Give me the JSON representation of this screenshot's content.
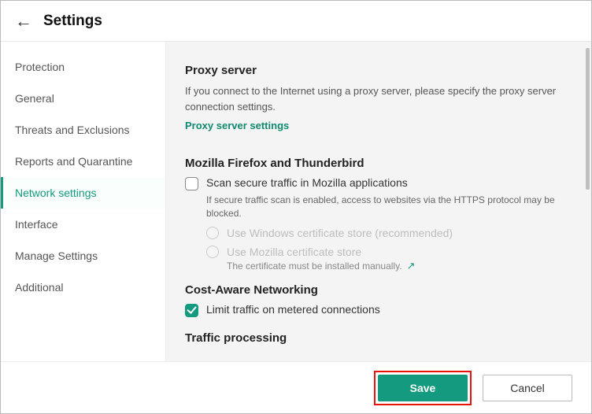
{
  "header": {
    "title": "Settings"
  },
  "sidebar": {
    "items": [
      {
        "label": "Protection"
      },
      {
        "label": "General"
      },
      {
        "label": "Threats and Exclusions"
      },
      {
        "label": "Reports and Quarantine"
      },
      {
        "label": "Network settings"
      },
      {
        "label": "Interface"
      },
      {
        "label": "Manage Settings"
      },
      {
        "label": "Additional"
      }
    ],
    "active_index": 4
  },
  "content": {
    "proxy": {
      "heading": "Proxy server",
      "desc": "If you connect to the Internet using a proxy server, please specify the proxy server connection settings.",
      "link": "Proxy server settings"
    },
    "mozilla": {
      "heading": "Mozilla Firefox and Thunderbird",
      "check_label": "Scan secure traffic in Mozilla applications",
      "subnote": "If secure traffic scan is enabled, access to websites via the HTTPS protocol may be blocked.",
      "radio1": "Use Windows certificate store (recommended)",
      "radio2": "Use Mozilla certificate store",
      "radio2_sub": "The certificate must be installed manually."
    },
    "cost": {
      "heading": "Cost-Aware Networking",
      "check_label": "Limit traffic on metered connections"
    },
    "traffic": {
      "heading": "Traffic processing"
    }
  },
  "footer": {
    "save": "Save",
    "cancel": "Cancel"
  }
}
